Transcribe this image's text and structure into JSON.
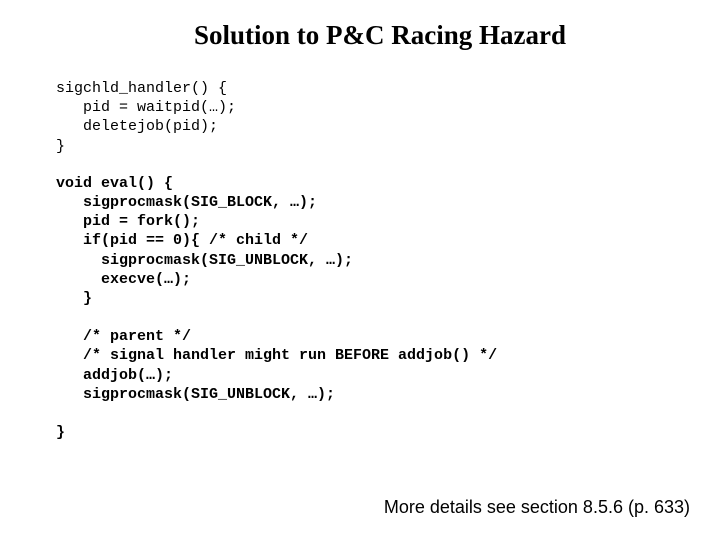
{
  "title": "Solution to P&C Racing Hazard",
  "code_top": "sigchld_handler() {\n   pid = waitpid(…);\n   deletejob(pid);\n}",
  "code_main": "void eval() {\n   sigprocmask(SIG_BLOCK, …);\n   pid = fork();\n   if(pid == 0){ /* child */\n     sigprocmask(SIG_UNBLOCK, …);\n     execve(…);\n   }\n\n   /* parent */\n   /* signal handler might run BEFORE addjob() */\n   addjob(…);\n   sigprocmask(SIG_UNBLOCK, …);\n\n}",
  "footnote": "More details see section 8.5.6 (p. 633)"
}
